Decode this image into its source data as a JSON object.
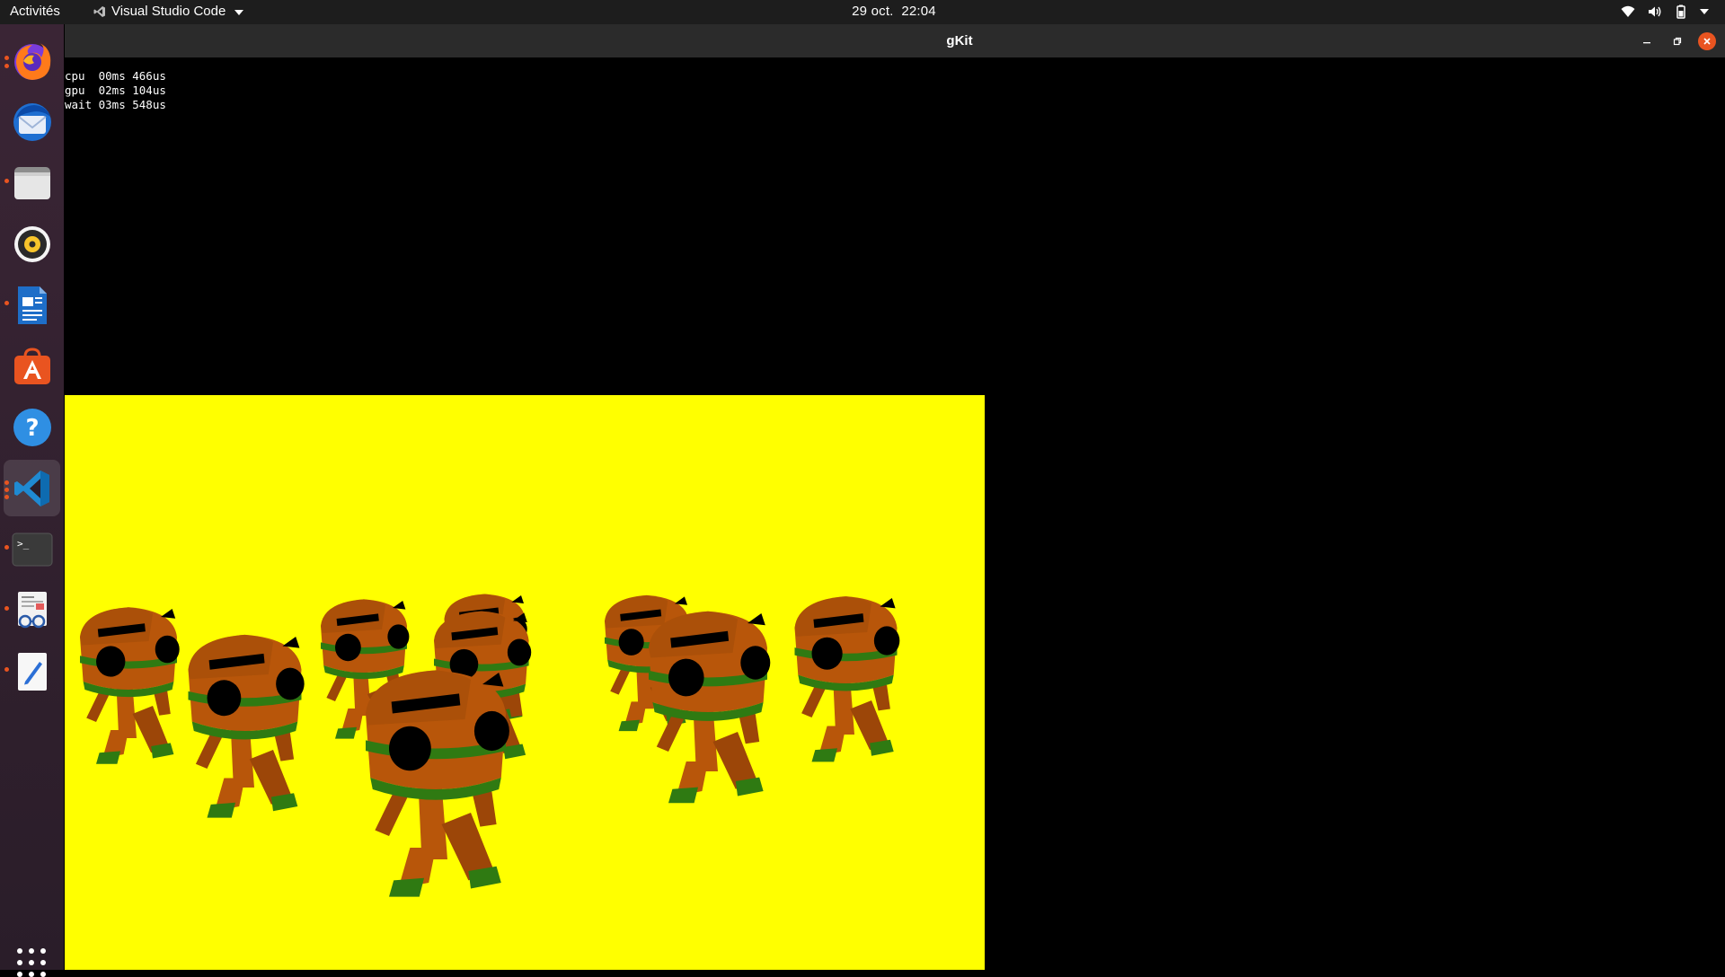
{
  "topbar": {
    "activities": "Activités",
    "app_name": "Visual Studio Code",
    "date": "29 oct.",
    "time": "22:04"
  },
  "dock": {
    "items": [
      {
        "name": "firefox",
        "icon": "firefox-icon",
        "running": true
      },
      {
        "name": "thunderbird",
        "icon": "thunderbird-icon",
        "running": false
      },
      {
        "name": "files",
        "icon": "files-icon",
        "running": true
      },
      {
        "name": "rhythmbox",
        "icon": "rhythmbox-icon",
        "running": false
      },
      {
        "name": "libreoffice-writer",
        "icon": "writer-icon",
        "running": true
      },
      {
        "name": "software",
        "icon": "software-icon",
        "running": false
      },
      {
        "name": "help",
        "icon": "help-icon",
        "running": false
      },
      {
        "name": "vscode",
        "icon": "vscode-icon",
        "running": true
      },
      {
        "name": "terminal",
        "icon": "terminal-icon",
        "running": true
      },
      {
        "name": "document-viewer",
        "icon": "document-viewer-icon",
        "running": true
      },
      {
        "name": "text-editor",
        "icon": "text-editor-icon",
        "running": true
      }
    ],
    "show_apps_icon": "app-grid-icon"
  },
  "window": {
    "title": "gKit",
    "stats": {
      "cpu": "cpu  00ms 466us",
      "gpu": "gpu  02ms 104us",
      "wait": "wait 03ms 548us"
    },
    "viewport_color": "#ffff00"
  },
  "colors": {
    "accent": "#e95420",
    "robot_body": "#b8560a",
    "robot_band": "#2f7a12"
  }
}
